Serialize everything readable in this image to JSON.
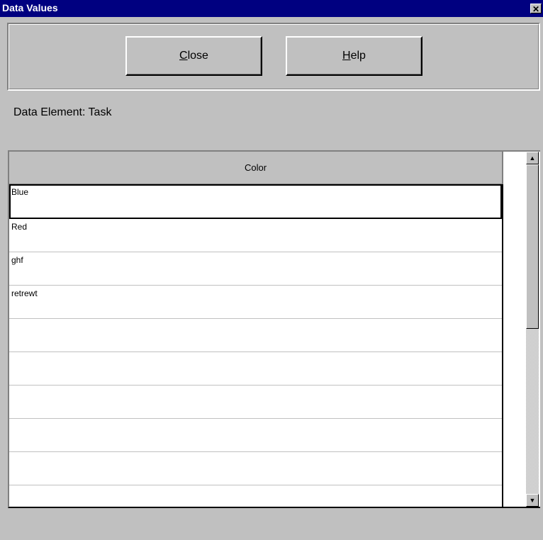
{
  "window": {
    "title": "Data Values",
    "close_glyph": "✕"
  },
  "toolbar": {
    "close_mnemonic": "C",
    "close_rest": "lose",
    "help_mnemonic": "H",
    "help_rest": "elp"
  },
  "data_element_label": "Data Element: Task",
  "grid": {
    "column_header": "Color",
    "rows": [
      "Blue",
      "Red",
      "ghf",
      "retrewt",
      "",
      "",
      "",
      "",
      "",
      ""
    ]
  },
  "scrollbar": {
    "up_icon": "triangle-up",
    "down_icon": "triangle-down"
  }
}
